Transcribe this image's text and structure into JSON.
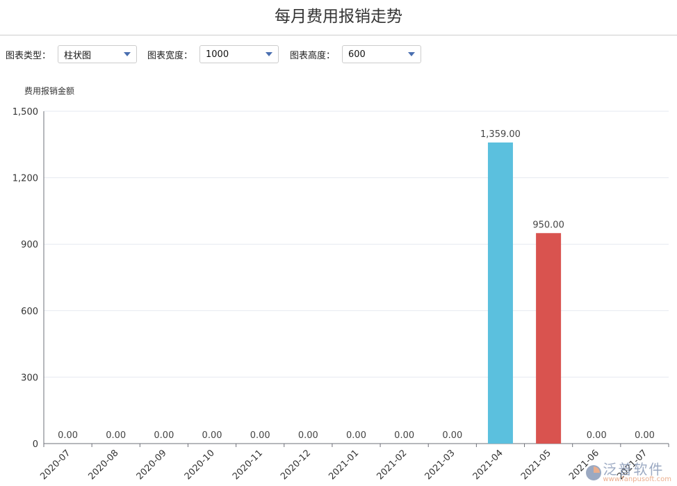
{
  "title": "每月费用报销走势",
  "controls": [
    {
      "label": "图表类型：",
      "value": "柱状图"
    },
    {
      "label": "图表宽度：",
      "value": "1000"
    },
    {
      "label": "图表高度：",
      "value": "600"
    }
  ],
  "watermark": {
    "name": "泛普软件",
    "url": "www.fanpusoft.com"
  },
  "chart_data": {
    "type": "bar",
    "ylabel": "费用报销金额",
    "categories": [
      "2020-07",
      "2020-08",
      "2020-09",
      "2020-10",
      "2020-11",
      "2020-12",
      "2021-01",
      "2021-02",
      "2021-03",
      "2021-04",
      "2021-05",
      "2021-06",
      "2021-07"
    ],
    "values": [
      0,
      0,
      0,
      0,
      0,
      0,
      0,
      0,
      0,
      1359,
      950,
      0,
      0
    ],
    "data_labels": [
      "0.00",
      "0.00",
      "0.00",
      "0.00",
      "0.00",
      "0.00",
      "0.00",
      "0.00",
      "0.00",
      "1,359.00",
      "950.00",
      "0.00",
      "0.00"
    ],
    "colors": [
      "#5bc0de",
      "#5bc0de",
      "#5bc0de",
      "#5bc0de",
      "#5bc0de",
      "#5bc0de",
      "#5bc0de",
      "#5bc0de",
      "#5bc0de",
      "#5bc0de",
      "#d9534f",
      "#5bc0de",
      "#5bc0de"
    ],
    "yticks": [
      0,
      300,
      600,
      900,
      1200,
      1500
    ],
    "ytick_labels": [
      "0",
      "300",
      "600",
      "900",
      "1,200",
      "1,500"
    ],
    "ylim": [
      0,
      1500
    ],
    "grid": true
  }
}
